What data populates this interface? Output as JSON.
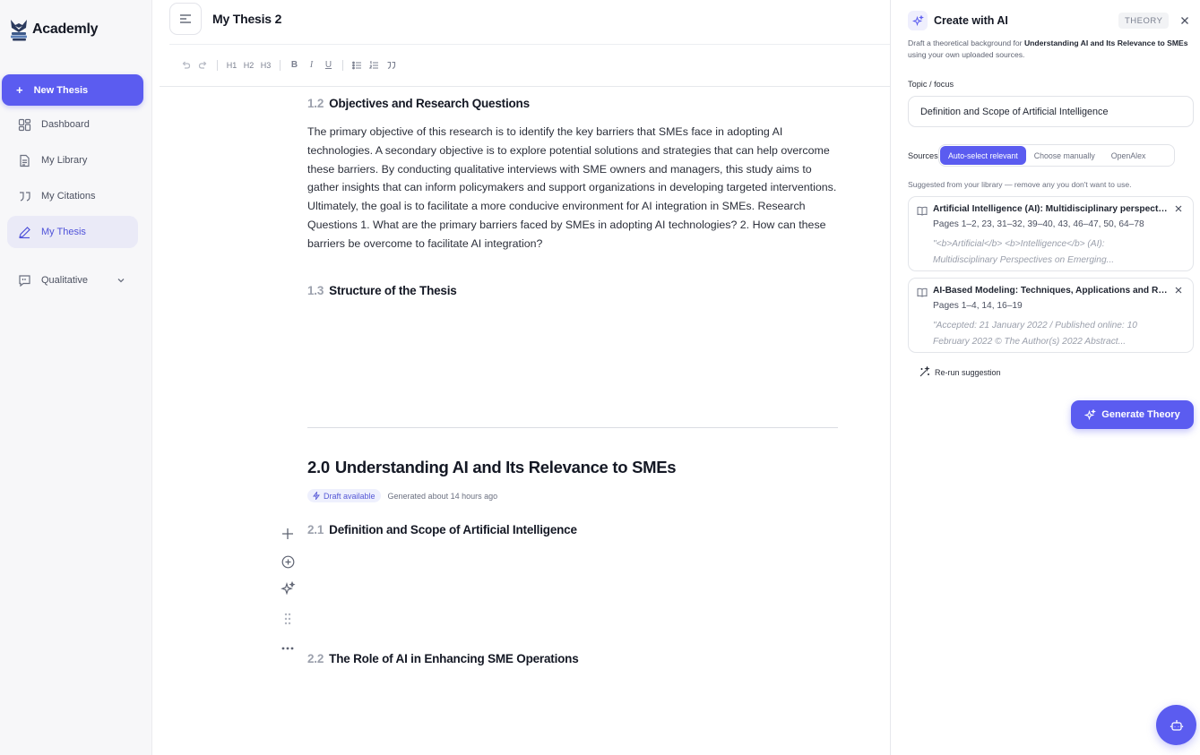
{
  "sidebar": {
    "brand": "Academly",
    "new_thesis": {
      "icon": "plus-icon",
      "label": "New Thesis"
    },
    "items": [
      {
        "icon": "dashboard-icon",
        "label": "Dashboard",
        "active": false
      },
      {
        "icon": "document-icon",
        "label": "My Library",
        "active": false
      },
      {
        "icon": "quote-icon",
        "label": "My Citations",
        "active": false
      },
      {
        "icon": "pen-icon",
        "label": "My Thesis",
        "active": true
      },
      {
        "icon": "chat-bracket-icon",
        "label": "Qualitative",
        "active": false,
        "expandable": true
      }
    ]
  },
  "editor": {
    "doc_title": "My Thesis 2",
    "toolbar": {
      "h1": "H1",
      "h2": "H2",
      "h3": "H3"
    },
    "section_1_2": {
      "num": "1.2",
      "title": "Objectives and Research Questions"
    },
    "paragraph": "The primary objective of this research is to identify the key barriers that SMEs face in adopting AI technologies. A secondary objective is to explore potential solutions and strategies that can help overcome these barriers. By conducting qualitative interviews with SME owners and managers, this study aims to gather insights that can inform policymakers and support organizations in developing targeted interventions. Ultimately, the goal is to facilitate a more conducive environment for AI integration in SMEs. Research Questions 1. What are the primary barriers faced by SMEs in adopting AI technologies? 2. How can these barriers be overcome to facilitate AI integration?",
    "section_1_3": {
      "num": "1.3",
      "title": "Structure of the Thesis"
    },
    "chapter_2": {
      "num": "2.0",
      "title": "Understanding AI and Its Relevance to SMEs"
    },
    "draft_badge": "Draft available",
    "generated": "Generated about 14 hours ago",
    "section_2_1": {
      "num": "2.1",
      "title": "Definition and Scope of Artificial Intelligence"
    },
    "section_2_2": {
      "num": "2.2",
      "title": "The Role of AI in Enhancing SME Operations"
    }
  },
  "panel": {
    "title": "Create with AI",
    "tag": "THEORY",
    "desc_prefix": "Draft a theoretical background for ",
    "desc_bold": "Understanding AI and Its Relevance to SMEs",
    "desc_suffix": " using your own uploaded sources.",
    "topic_label": "Topic / focus",
    "topic_value": "Definition and Scope of Artificial Intelligence",
    "sources_label": "Sources",
    "source_modes": [
      "Auto-select relevant",
      "Choose manually",
      "OpenAlex"
    ],
    "source_mode_selected": "Auto-select relevant",
    "suggest_note": "Suggested from your library — remove any you don't want to use.",
    "sources": [
      {
        "title": "Artificial Intelligence (AI): Multidisciplinary perspectives on emerging challenges",
        "pages": "Pages 1–2, 23, 31–32, 39–40, 43, 46–47, 50, 64–78",
        "quote": "\"<b>Artificial</b> <b>Intelligence</b> (AI): Multidisciplinary Perspectives on Emerging..."
      },
      {
        "title": "AI-Based Modeling: Techniques, Applications and Research Issues",
        "pages": "Pages 1–4, 14, 16–19",
        "quote": "\"Accepted: 21 January 2022 / Published online: 10 February 2022 © The Author(s) 2022 Abstract..."
      }
    ],
    "rerun": "Re-run suggestion",
    "generate": "Generate Theory"
  },
  "colors": {
    "accent": "#5b5cf0",
    "active_nav_bg": "#eaeaf7",
    "muted": "#9ca1ad"
  }
}
